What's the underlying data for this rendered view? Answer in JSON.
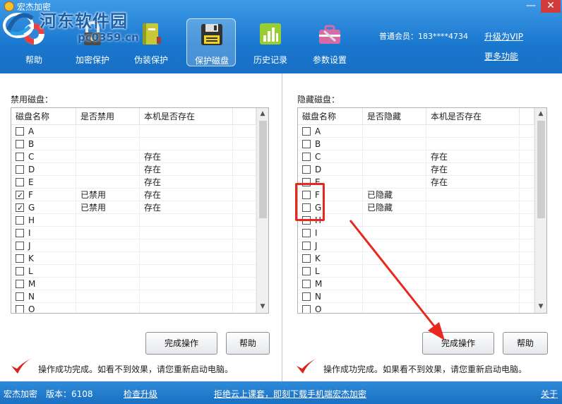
{
  "app": {
    "title": "宏杰加密"
  },
  "watermark": {
    "line1": "河东软件园",
    "line2": "pc0359.cn"
  },
  "nav": [
    {
      "label": "帮助",
      "icon": "lifebuoy-icon"
    },
    {
      "label": "加密保护",
      "icon": "lock-icon"
    },
    {
      "label": "伪装保护",
      "icon": "notebook-icon"
    },
    {
      "label": "保护磁盘",
      "icon": "floppy-disk-icon",
      "active": true
    },
    {
      "label": "历史记录",
      "icon": "history-grid-icon"
    },
    {
      "label": "参数设置",
      "icon": "toolbox-icon"
    }
  ],
  "account": {
    "member": "普通会员：183****4734",
    "upgrade": "升级为VIP",
    "more": "更多功能"
  },
  "left": {
    "label": "禁用磁盘：",
    "headers": [
      "磁盘名称",
      "是否禁用",
      "本机是否存在"
    ],
    "rows": [
      {
        "name": "A",
        "status": "",
        "exists": "",
        "checked": false
      },
      {
        "name": "B",
        "status": "",
        "exists": "",
        "checked": false
      },
      {
        "name": "C",
        "status": "",
        "exists": "存在",
        "checked": false
      },
      {
        "name": "D",
        "status": "",
        "exists": "存在",
        "checked": false
      },
      {
        "name": "E",
        "status": "",
        "exists": "存在",
        "checked": false
      },
      {
        "name": "F",
        "status": "已禁用",
        "exists": "存在",
        "checked": true
      },
      {
        "name": "G",
        "status": "已禁用",
        "exists": "存在",
        "checked": true
      },
      {
        "name": "H",
        "status": "",
        "exists": "",
        "checked": false
      },
      {
        "name": "I",
        "status": "",
        "exists": "",
        "checked": false
      },
      {
        "name": "J",
        "status": "",
        "exists": "",
        "checked": false
      },
      {
        "name": "K",
        "status": "",
        "exists": "",
        "checked": false
      },
      {
        "name": "L",
        "status": "",
        "exists": "",
        "checked": false
      },
      {
        "name": "M",
        "status": "",
        "exists": "",
        "checked": false
      },
      {
        "name": "N",
        "status": "",
        "exists": "",
        "checked": false
      },
      {
        "name": "O",
        "status": "",
        "exists": "",
        "checked": false
      }
    ],
    "done_button": "完成操作",
    "help_button": "帮助",
    "status": "操作成功完成。如看不到效果，请您重新启动电脑。"
  },
  "right": {
    "label": "隐藏磁盘：",
    "headers": [
      "磁盘名称",
      "是否隐藏",
      "本机是否存在"
    ],
    "rows": [
      {
        "name": "A",
        "status": "",
        "exists": "",
        "checked": false
      },
      {
        "name": "B",
        "status": "",
        "exists": "",
        "checked": false
      },
      {
        "name": "C",
        "status": "",
        "exists": "存在",
        "checked": false
      },
      {
        "name": "D",
        "status": "",
        "exists": "存在",
        "checked": false
      },
      {
        "name": "E",
        "status": "",
        "exists": "存在",
        "checked": false
      },
      {
        "name": "F",
        "status": "已隐藏",
        "exists": "",
        "checked": false
      },
      {
        "name": "G",
        "status": "已隐藏",
        "exists": "",
        "checked": false
      },
      {
        "name": "H",
        "status": "",
        "exists": "",
        "checked": false
      },
      {
        "name": "I",
        "status": "",
        "exists": "",
        "checked": false
      },
      {
        "name": "J",
        "status": "",
        "exists": "",
        "checked": false
      },
      {
        "name": "K",
        "status": "",
        "exists": "",
        "checked": false
      },
      {
        "name": "L",
        "status": "",
        "exists": "",
        "checked": false
      },
      {
        "name": "M",
        "status": "",
        "exists": "",
        "checked": false
      },
      {
        "name": "N",
        "status": "",
        "exists": "",
        "checked": false
      },
      {
        "name": "O",
        "status": "",
        "exists": "",
        "checked": false
      }
    ],
    "done_button": "完成操作",
    "help_button": "帮助",
    "status": "操作成功完成。如果看不到效果，请您重新启动电脑。"
  },
  "footer": {
    "app_name": "宏杰加密",
    "version": "版本：6108",
    "check_update": "检查升级",
    "promo": "拒绝云上课套，即刻下载手机端宏杰加密",
    "about": "关于"
  },
  "colors": {
    "header_blue": "#1a78cf",
    "annotation_red": "#e8281e",
    "check_red": "#d8221a"
  }
}
